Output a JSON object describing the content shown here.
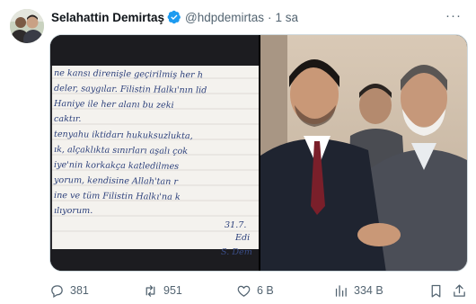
{
  "author": {
    "name": "Selahattin Demirtaş",
    "handle": "@hdpdemirtas",
    "separator": "·",
    "time": "1 sa",
    "verified": true
  },
  "more_label": "···",
  "letter": {
    "lines": [
      "ne kansı direnişle geçirilmiş her h",
      "deler, saygılar. Filistin Halkı'nın lid",
      "Haniye ile her alanı bu zeki",
      "caktır.",
      "tenyahu iktidarı hukuksuzlukta,",
      "ık, alçaklıkta sınırları aşalı çok",
      "iye'nin korkakça katledilmes",
      "yorum, kendisine Allah'tan r",
      "ine ve tüm Filistin Halkı'na k",
      "ılıyorum."
    ],
    "date_partial": "31.7.",
    "place_partial": "Edi",
    "signature_partial": "S. Dem"
  },
  "actions": {
    "replies": "381",
    "reposts": "951",
    "likes": "6 B",
    "views": "334 B"
  },
  "colors": {
    "text": "#0f1419",
    "secondary": "#536471",
    "verified": "#1d9bf0",
    "border": "#cfd9de"
  },
  "icons": [
    "reply-icon",
    "repost-icon",
    "like-icon",
    "views-icon",
    "bookmark-icon",
    "share-icon",
    "verified-badge-icon"
  ]
}
